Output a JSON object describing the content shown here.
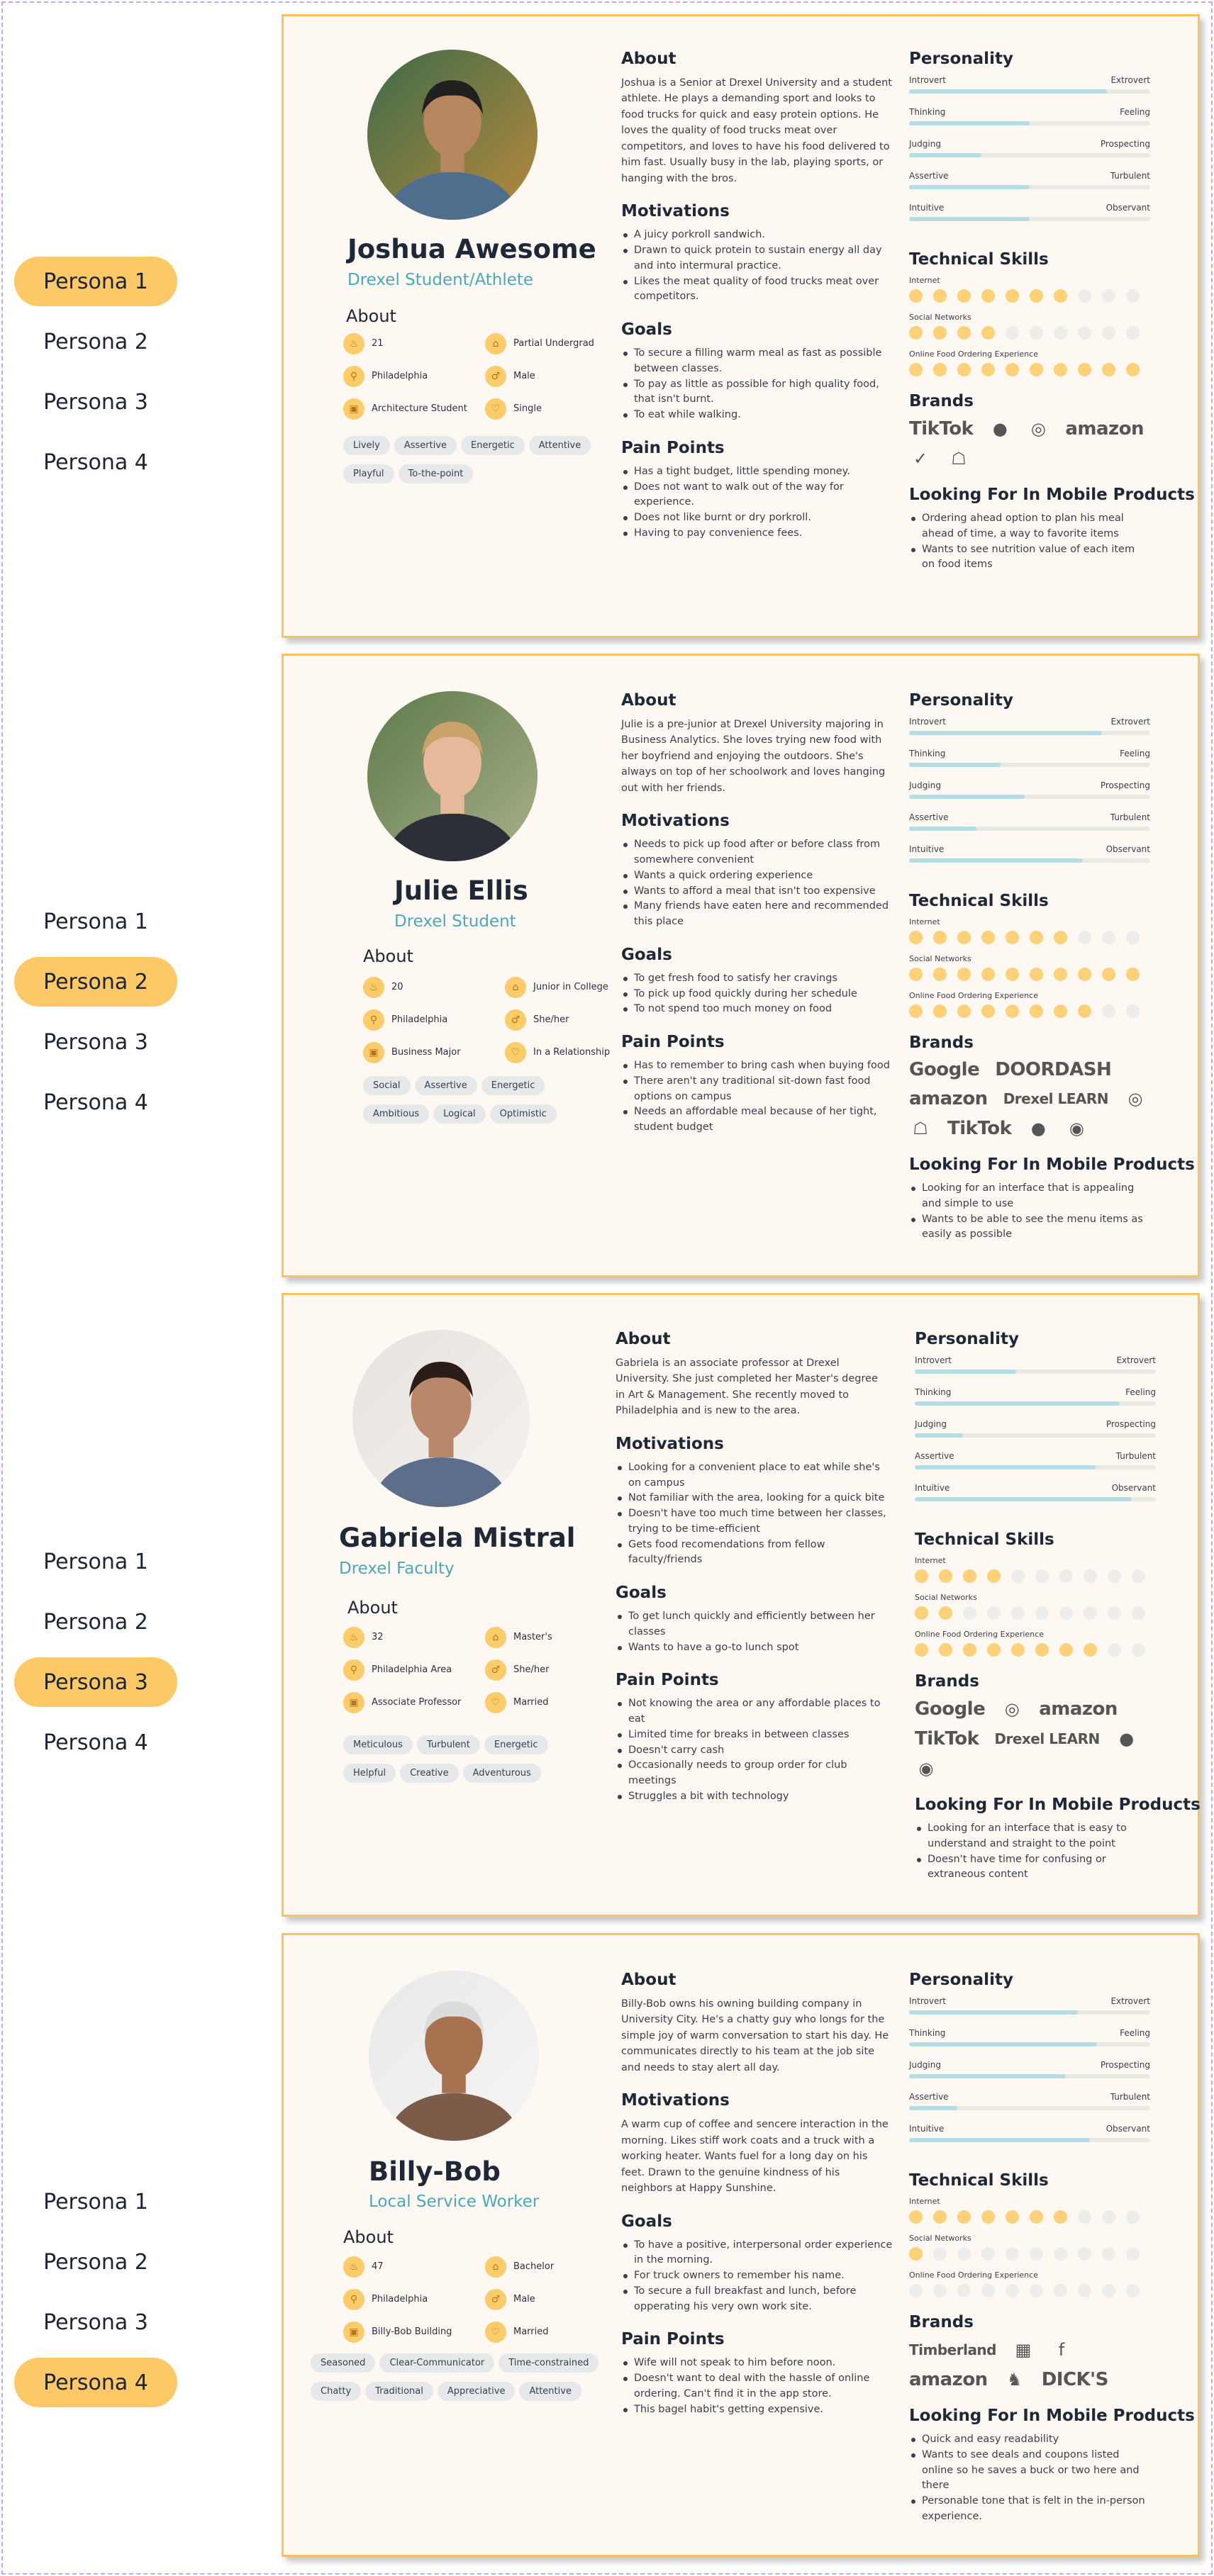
{
  "nav": [
    "Persona 1",
    "Persona 2",
    "Persona 3",
    "Persona 4"
  ],
  "colors": {
    "accent": "#fdc866",
    "card_border": "#fbc45b",
    "role": "#4aa8b7",
    "slider_fill": "#b5dde4",
    "dot_on": "#fcd178"
  },
  "headings": {
    "about": "About",
    "motivations": "Motivations",
    "goals": "Goals",
    "pain_points": "Pain Points",
    "personality": "Personality",
    "technical_skills": "Technical Skills",
    "brands": "Brands",
    "looking_for": "Looking For In Mobile Products"
  },
  "skill_labels": [
    "Internet",
    "Social Networks",
    "Online Food Ordering Experience"
  ],
  "personas": [
    {
      "name": "Joshua Awesome",
      "role": "Drexel Student/Athlete",
      "facts": [
        {
          "icon": "cake-icon",
          "text": "21"
        },
        {
          "icon": "graduation-cap-icon",
          "text": "Partial Undergrad"
        },
        {
          "icon": "location-pin-icon",
          "text": "Philadelphia"
        },
        {
          "icon": "gender-icon",
          "text": "Male"
        },
        {
          "icon": "briefcase-icon",
          "text": "Architecture Student"
        },
        {
          "icon": "heart-icon",
          "text": "Single"
        }
      ],
      "tags": [
        "Lively",
        "Assertive",
        "Energetic",
        "Attentive",
        "Playful",
        "To-the-point"
      ],
      "about": "Joshua is a Senior at Drexel University and a student athlete. He plays a demanding sport and looks to food trucks for quick and easy protein options. He loves the quality of food trucks meat over competitors, and loves to have his food delivered to him fast. Usually busy in the lab, playing sports, or hanging with the bros.",
      "motivations": [
        "A juicy porkroll sandwich.",
        "Drawn to quick protein to sustain energy all day and into intermural practice.",
        "Likes the meat quality of food trucks meat over competitors."
      ],
      "goals": [
        "To secure a filling warm meal as fast as possible between classes.",
        "To pay as little as possible for high quality food, that isn't burnt.",
        "To eat while walking."
      ],
      "pain_points": [
        "Has a tight budget, little spending money.",
        "Does not want to walk out of the way for experience.",
        "Does not like burnt or dry porkroll.",
        "Having to pay convenience fees."
      ],
      "personality": [
        {
          "left": "Introvert",
          "right": "Extrovert",
          "value": 0.82
        },
        {
          "left": "Thinking",
          "right": "Feeling",
          "value": 0.5
        },
        {
          "left": "Judging",
          "right": "Prospecting",
          "value": 0.3
        },
        {
          "left": "Assertive",
          "right": "Turbulent",
          "value": 0.5
        },
        {
          "left": "Intuitive",
          "right": "Observant",
          "value": 0.5
        }
      ],
      "skills": [
        7,
        4,
        10
      ],
      "brands": [
        {
          "name": "TikTok",
          "icon": "tiktok-icon"
        },
        {
          "name": "",
          "icon": "apple-icon"
        },
        {
          "name": "",
          "icon": "instagram-icon"
        },
        {
          "name": "amazon",
          "icon": "amazon-icon"
        },
        {
          "name": "",
          "icon": "nike-icon"
        },
        {
          "name": "",
          "icon": "snapchat-icon"
        }
      ],
      "looking_for": [
        "Ordering ahead option to plan his meal ahead of time, a way to favorite items",
        "Wants to see nutrition value of each item on food items"
      ]
    },
    {
      "name": "Julie Ellis",
      "role": "Drexel Student",
      "facts": [
        {
          "icon": "cake-icon",
          "text": "20"
        },
        {
          "icon": "graduation-cap-icon",
          "text": "Junior in College"
        },
        {
          "icon": "location-pin-icon",
          "text": "Philadelphia"
        },
        {
          "icon": "gender-icon",
          "text": "She/her"
        },
        {
          "icon": "briefcase-icon",
          "text": "Business Major"
        },
        {
          "icon": "heart-icon",
          "text": "In a Relationship"
        }
      ],
      "tags": [
        "Social",
        "Assertive",
        "Energetic",
        "Ambitious",
        "Logical",
        "Optimistic"
      ],
      "about": "Julie is a pre-junior at Drexel University majoring in Business Analytics. She loves trying new food with her boyfriend and enjoying the outdoors. She's always on top of her schoolwork and loves hanging out with her friends.",
      "motivations": [
        "Needs to pick up food after or before class from somewhere convenient",
        "Wants a quick ordering experience",
        "Wants to afford a meal that isn't too expensive",
        "Many friends have eaten here and recommended this place"
      ],
      "goals": [
        "To get fresh food to satisfy her cravings",
        "To pick up food quickly during her schedule",
        "To not spend too much money on food"
      ],
      "pain_points": [
        "Has to remember to bring cash when buying food",
        "There aren't any traditional sit-down fast food options on campus",
        "Needs an affordable meal because of her tight, student budget"
      ],
      "personality": [
        {
          "left": "Introvert",
          "right": "Extrovert",
          "value": 0.8
        },
        {
          "left": "Thinking",
          "right": "Feeling",
          "value": 0.38
        },
        {
          "left": "Judging",
          "right": "Prospecting",
          "value": 0.48
        },
        {
          "left": "Assertive",
          "right": "Turbulent",
          "value": 0.28
        },
        {
          "left": "Intuitive",
          "right": "Observant",
          "value": 0.72
        }
      ],
      "skills": [
        7,
        10,
        8
      ],
      "brands": [
        {
          "name": "Google",
          "icon": "google-icon"
        },
        {
          "name": "DOORDASH",
          "icon": "doordash-icon"
        },
        {
          "name": "amazon",
          "icon": "amazon-icon"
        },
        {
          "name": "Drexel LEARN",
          "icon": "drexel-learn-icon"
        },
        {
          "name": "",
          "icon": "instagram-icon"
        },
        {
          "name": "",
          "icon": "snapchat-icon"
        },
        {
          "name": "TikTok",
          "icon": "tiktok-icon"
        },
        {
          "name": "",
          "icon": "apple-icon"
        },
        {
          "name": "",
          "icon": "spotify-icon"
        }
      ],
      "looking_for": [
        "Looking for an interface that is appealing and simple to use",
        "Wants to be able to see the menu items as easily as possible"
      ]
    },
    {
      "name": "Gabriela Mistral",
      "role": "Drexel Faculty",
      "facts": [
        {
          "icon": "cake-icon",
          "text": "32"
        },
        {
          "icon": "graduation-cap-icon",
          "text": "Master's"
        },
        {
          "icon": "location-pin-icon",
          "text": "Philadelphia Area"
        },
        {
          "icon": "gender-icon",
          "text": "She/her"
        },
        {
          "icon": "briefcase-icon",
          "text": "Associate Professor"
        },
        {
          "icon": "heart-icon",
          "text": "Married"
        }
      ],
      "tags": [
        "Meticulous",
        "Turbulent",
        "Energetic",
        "Helpful",
        "Creative",
        "Adventurous"
      ],
      "about": "Gabriela is an associate professor at Drexel University. She just completed her Master's degree in Art & Management. She recently moved to Philadelphia and is new to the area.",
      "motivations": [
        "Looking for a convenient place to eat while she's on campus",
        "Not familiar with the area, looking for a quick bite",
        "Doesn't have too much time between her classes, trying to be time-efficient",
        "Gets food recomendations from fellow faculty/friends"
      ],
      "goals": [
        "To get lunch quickly and efficiently between her classes",
        "Wants to have a go-to lunch spot"
      ],
      "pain_points": [
        "Not knowing the area or any affordable places to eat",
        "Limited time for breaks in between classes",
        "Doesn't carry cash",
        "Occasionally needs to group order for club meetings",
        "Struggles a bit with technology"
      ],
      "personality": [
        {
          "left": "Introvert",
          "right": "Extrovert",
          "value": 0.42
        },
        {
          "left": "Thinking",
          "right": "Feeling",
          "value": 0.85
        },
        {
          "left": "Judging",
          "right": "Prospecting",
          "value": 0.2
        },
        {
          "left": "Assertive",
          "right": "Turbulent",
          "value": 0.75
        },
        {
          "left": "Intuitive",
          "right": "Observant",
          "value": 0.9
        }
      ],
      "skills": [
        4,
        2,
        8
      ],
      "brands": [
        {
          "name": "Google",
          "icon": "google-icon"
        },
        {
          "name": "",
          "icon": "instagram-icon"
        },
        {
          "name": "amazon",
          "icon": "amazon-icon"
        },
        {
          "name": "TikTok",
          "icon": "tiktok-icon"
        },
        {
          "name": "Drexel LEARN",
          "icon": "drexel-learn-icon"
        },
        {
          "name": "",
          "icon": "apple-icon"
        },
        {
          "name": "",
          "icon": "spotify-icon"
        }
      ],
      "looking_for": [
        "Looking for an interface that is easy to understand and straight to the point",
        "Doesn't have time for confusing or extraneous content"
      ]
    },
    {
      "name": "Billy-Bob",
      "role": "Local Service Worker",
      "facts": [
        {
          "icon": "cake-icon",
          "text": "47"
        },
        {
          "icon": "graduation-cap-icon",
          "text": "Bachelor"
        },
        {
          "icon": "location-pin-icon",
          "text": "Philadelphia"
        },
        {
          "icon": "gender-icon",
          "text": "Male"
        },
        {
          "icon": "briefcase-icon",
          "text": "Billy-Bob Building"
        },
        {
          "icon": "heart-icon",
          "text": "Married"
        }
      ],
      "tags": [
        "Seasoned",
        "Clear-Communicator",
        "Time-constrained",
        "Chatty",
        "Traditional",
        "Appreciative",
        "Attentive"
      ],
      "about": "Billy-Bob owns his owning building company in University City. He's a chatty guy who longs for the simple joy of warm conversation to start his day. He communicates directly to his team at the job site and needs to stay alert all day.",
      "motivations_text": "A warm cup of coffee and sencere interaction in the morning. Likes stiff work coats and a truck with a working heater. Wants fuel for a long day on his feet. Drawn to the genuine kindness of his neighbors at Happy Sunshine.",
      "goals": [
        "To have a positive, interpersonal order experience in the morning.",
        "For truck owners to remember his name.",
        "To secure a full breakfast and lunch, before opperating his very own work site."
      ],
      "pain_points": [
        "Wife will not speak to him before noon.",
        "Doesn't want to deal with the hassle of online ordering. Can't find it in the app store.",
        "This bagel habit's getting expensive."
      ],
      "personality": [
        {
          "left": "Introvert",
          "right": "Extrovert",
          "value": 0.7
        },
        {
          "left": "Thinking",
          "right": "Feeling",
          "value": 0.78
        },
        {
          "left": "Judging",
          "right": "Prospecting",
          "value": 0.65
        },
        {
          "left": "Assertive",
          "right": "Turbulent",
          "value": 0.2
        },
        {
          "left": "Intuitive",
          "right": "Observant",
          "value": 0.75
        }
      ],
      "skills": [
        7,
        1,
        0
      ],
      "brands": [
        {
          "name": "Timberland",
          "icon": "timberland-icon"
        },
        {
          "name": "",
          "icon": "home-depot-icon"
        },
        {
          "name": "",
          "icon": "facebook-icon"
        },
        {
          "name": "amazon",
          "icon": "amazon-icon"
        },
        {
          "name": "",
          "icon": "john-deere-icon"
        },
        {
          "name": "DICK'S",
          "icon": "dicks-icon"
        }
      ],
      "looking_for": [
        "Quick and easy readability",
        "Wants to see deals and coupons listed online so he saves a buck or two here and there",
        "Personable tone that is felt in the in-person experience."
      ]
    }
  ]
}
